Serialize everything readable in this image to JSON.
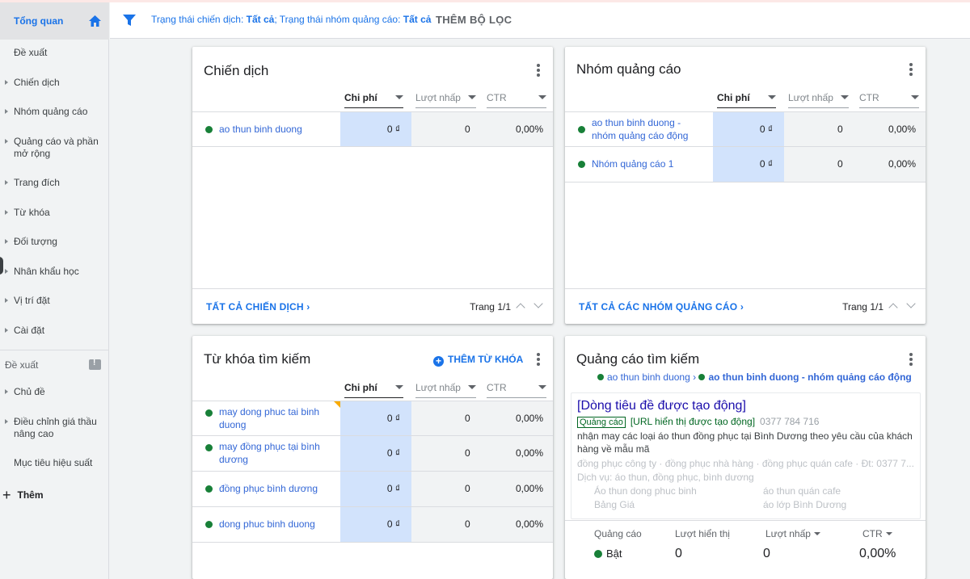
{
  "sidebar": {
    "active": "Tổng quan",
    "items": [
      "Đề xuất",
      "Chiến dịch",
      "Nhóm quảng cáo",
      "Quảng cáo và phần mở rộng",
      "Trang đích",
      "Từ khóa",
      "Đối tượng",
      "Nhân khẩu học",
      "Vị trí đặt",
      "Cài đặt"
    ],
    "section_label": "Đề xuất",
    "section_items": [
      "Chủ đề",
      "Điều chỉnh giá thầu nâng cao",
      "Mục tiêu hiệu suất"
    ],
    "add_label": "Thêm"
  },
  "filter": {
    "campaign_status_label": "Trạng thái chiến dịch:",
    "campaign_status_value": "Tất cả",
    "adgroup_status_label": "; Trạng thái nhóm quảng cáo:",
    "adgroup_status_value": "Tất cả",
    "add_filter": "THÊM BỘ LỌC"
  },
  "columns": {
    "cost": "Chi phí",
    "clicks": "Lượt nhấp",
    "ctr": "CTR"
  },
  "campaigns": {
    "title": "Chiến dịch",
    "rows": [
      {
        "name": "ao thun binh duong",
        "cost": "0 ₫",
        "clicks": "0",
        "ctr": "0,00%"
      }
    ],
    "footer_link": "TẤT CẢ CHIẾN DỊCH",
    "page": "Trang 1/1"
  },
  "adgroups": {
    "title": "Nhóm quảng cáo",
    "rows": [
      {
        "name": "ao thun binh duong - nhóm quảng cáo động",
        "cost": "0 ₫",
        "clicks": "0",
        "ctr": "0,00%"
      },
      {
        "name": "Nhóm quảng cáo 1",
        "cost": "0 ₫",
        "clicks": "0",
        "ctr": "0,00%"
      }
    ],
    "footer_link": "TẤT CẢ CÁC NHÓM QUẢNG CÁO",
    "page": "Trang 1/1"
  },
  "keywords": {
    "title": "Từ khóa tìm kiếm",
    "add_label": "THÊM TỪ KHÓA",
    "rows": [
      {
        "name": "may dong phuc tai binh duong",
        "cost": "0 ₫",
        "clicks": "0",
        "ctr": "0,00%"
      },
      {
        "name": "may đồng phục tại bình dương",
        "cost": "0 ₫",
        "clicks": "0",
        "ctr": "0,00%"
      },
      {
        "name": "đồng phục bình dương",
        "cost": "0 ₫",
        "clicks": "0",
        "ctr": "0,00%"
      },
      {
        "name": "dong phuc binh duong",
        "cost": "0 ₫",
        "clicks": "0",
        "ctr": "0,00%"
      }
    ]
  },
  "search_ads": {
    "title": "Quảng cáo tìm kiếm",
    "breadcrumb_campaign": "ao thun binh duong",
    "breadcrumb_sep": "›",
    "breadcrumb_adgroup": "ao thun binh duong - nhóm quảng cáo động",
    "headline": "[Dòng tiêu đề được tạo động]",
    "badge": "Quảng cáo",
    "display_url": "[URL hiển thị được tạo động]",
    "phone": "0377 784 716",
    "description": "nhận may các loại áo thun đồng phục tại Bình Dương theo yêu cầu của khách hàng về mẫu mã",
    "callouts": "đồng phục công ty · đồng phục nhà hàng · đồng phục quán cafe · Đt: 0377 7...",
    "services": "Dịch vụ: áo thun, đồng phục, bình dương",
    "sitelinks": [
      "Áo thun dong phuc binh",
      "áo thun quán cafe",
      "Bảng Giá",
      "áo lớp Bình Dương"
    ],
    "stats_headers": {
      "ad": "Quảng cáo",
      "impressions": "Lượt hiển thị",
      "clicks": "Lượt nhấp",
      "ctr": "CTR"
    },
    "stats_values": {
      "status": "Bật",
      "impressions": "0",
      "clicks": "0",
      "ctr": "0,00%"
    }
  }
}
